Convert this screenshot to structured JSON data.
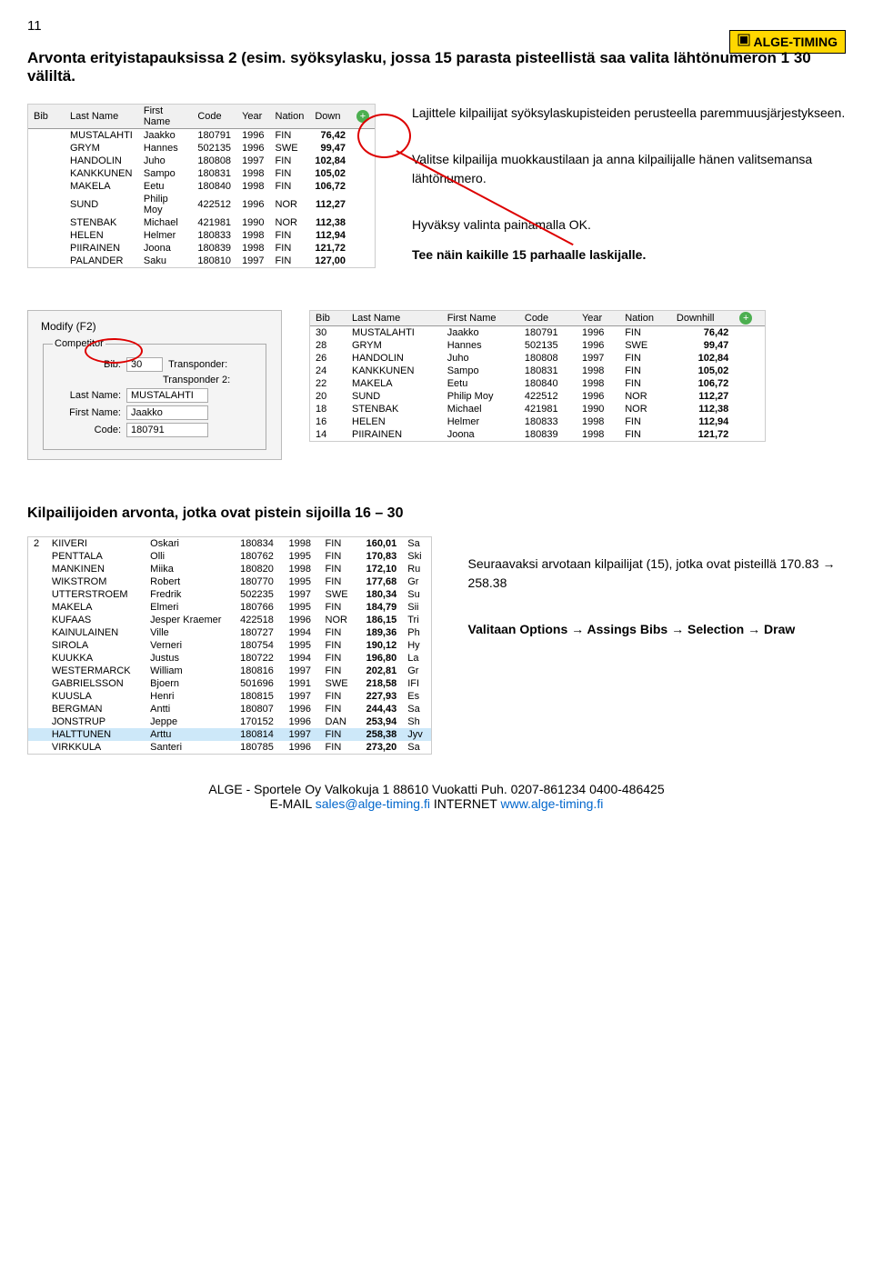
{
  "page_number": "11",
  "logo_text": "ALGE-TIMING",
  "title": "Arvonta erityistapauksissa 2 (esim. syöksylasku, jossa 15 parasta pisteellistä saa valita lähtönumeron 1 30 väliltä.",
  "table1": {
    "headers": [
      "Bib",
      "Last Name",
      "First Name",
      "Code",
      "Year",
      "Nation",
      "Down"
    ],
    "rows": [
      [
        "",
        "MUSTALAHTI",
        "Jaakko",
        "180791",
        "1996",
        "FIN",
        "76,42"
      ],
      [
        "",
        "GRYM",
        "Hannes",
        "502135",
        "1996",
        "SWE",
        "99,47"
      ],
      [
        "",
        "HANDOLIN",
        "Juho",
        "180808",
        "1997",
        "FIN",
        "102,84"
      ],
      [
        "",
        "KANKKUNEN",
        "Sampo",
        "180831",
        "1998",
        "FIN",
        "105,02"
      ],
      [
        "",
        "MAKELA",
        "Eetu",
        "180840",
        "1998",
        "FIN",
        "106,72"
      ],
      [
        "",
        "SUND",
        "Philip Moy",
        "422512",
        "1996",
        "NOR",
        "112,27"
      ],
      [
        "",
        "STENBAK",
        "Michael",
        "421981",
        "1990",
        "NOR",
        "112,38"
      ],
      [
        "",
        "HELEN",
        "Helmer",
        "180833",
        "1998",
        "FIN",
        "112,94"
      ],
      [
        "",
        "PIIRAINEN",
        "Joona",
        "180839",
        "1998",
        "FIN",
        "121,72"
      ],
      [
        "",
        "PALANDER",
        "Saku",
        "180810",
        "1997",
        "FIN",
        "127,00"
      ]
    ]
  },
  "info1": "Lajittele kilpailijat syöksylaskupisteiden perusteella paremmuusjärjestykseen.",
  "info2": "Valitse kilpailija muokkaustilaan ja anna kilpailijalle hänen valitsemansa lähtönumero.",
  "info3": "Hyväksy valinta painamalla OK.",
  "info4": "Tee näin kaikille 15 parhaalle laskijalle.",
  "modify": {
    "title": "Modify (F2)",
    "legend": "Competitor",
    "bib_lbl": "Bib:",
    "bib_val": "30",
    "tr_lbl": "Transponder:",
    "tr2_lbl": "Transponder 2:",
    "ln_lbl": "Last Name:",
    "ln_val": "MUSTALAHTI",
    "fn_lbl": "First Name:",
    "fn_val": "Jaakko",
    "code_lbl": "Code:",
    "code_val": "180791"
  },
  "table2": {
    "headers": [
      "Bib",
      "Last Name",
      "First Name",
      "Code",
      "Year",
      "Nation",
      "Downhill"
    ],
    "rows": [
      [
        "30",
        "MUSTALAHTI",
        "Jaakko",
        "180791",
        "1996",
        "FIN",
        "76,42"
      ],
      [
        "28",
        "GRYM",
        "Hannes",
        "502135",
        "1996",
        "SWE",
        "99,47"
      ],
      [
        "26",
        "HANDOLIN",
        "Juho",
        "180808",
        "1997",
        "FIN",
        "102,84"
      ],
      [
        "24",
        "KANKKUNEN",
        "Sampo",
        "180831",
        "1998",
        "FIN",
        "105,02"
      ],
      [
        "22",
        "MAKELA",
        "Eetu",
        "180840",
        "1998",
        "FIN",
        "106,72"
      ],
      [
        "20",
        "SUND",
        "Philip Moy",
        "422512",
        "1996",
        "NOR",
        "112,27"
      ],
      [
        "18",
        "STENBAK",
        "Michael",
        "421981",
        "1990",
        "NOR",
        "112,38"
      ],
      [
        "16",
        "HELEN",
        "Helmer",
        "180833",
        "1998",
        "FIN",
        "112,94"
      ],
      [
        "14",
        "PIIRAINEN",
        "Joona",
        "180839",
        "1998",
        "FIN",
        "121,72"
      ]
    ]
  },
  "section2_title": "Kilpailijoiden arvonta, jotka ovat pistein sijoilla 16 – 30",
  "table3": {
    "rows": [
      [
        "2",
        "KIIVERI",
        "Oskari",
        "180834",
        "1998",
        "FIN",
        "160,01",
        "Sa"
      ],
      [
        "",
        "PENTTALA",
        "Olli",
        "180762",
        "1995",
        "FIN",
        "170,83",
        "Ski"
      ],
      [
        "",
        "MANKINEN",
        "Miika",
        "180820",
        "1998",
        "FIN",
        "172,10",
        "Ru"
      ],
      [
        "",
        "WIKSTROM",
        "Robert",
        "180770",
        "1995",
        "FIN",
        "177,68",
        "Gr"
      ],
      [
        "",
        "UTTERSTROEM",
        "Fredrik",
        "502235",
        "1997",
        "SWE",
        "180,34",
        "Su"
      ],
      [
        "",
        "MAKELA",
        "Elmeri",
        "180766",
        "1995",
        "FIN",
        "184,79",
        "Sii"
      ],
      [
        "",
        "KUFAAS",
        "Jesper Kraemer",
        "422518",
        "1996",
        "NOR",
        "186,15",
        "Tri"
      ],
      [
        "",
        "KAINULAINEN",
        "Ville",
        "180727",
        "1994",
        "FIN",
        "189,36",
        "Ph"
      ],
      [
        "",
        "SIROLA",
        "Verneri",
        "180754",
        "1995",
        "FIN",
        "190,12",
        "Hy"
      ],
      [
        "",
        "KUUKKA",
        "Justus",
        "180722",
        "1994",
        "FIN",
        "196,80",
        "La"
      ],
      [
        "",
        "WESTERMARCK",
        "William",
        "180816",
        "1997",
        "FIN",
        "202,81",
        "Gr"
      ],
      [
        "",
        "GABRIELSSON",
        "Bjoern",
        "501696",
        "1991",
        "SWE",
        "218,58",
        "IFI"
      ],
      [
        "",
        "KUUSLA",
        "Henri",
        "180815",
        "1997",
        "FIN",
        "227,93",
        "Es"
      ],
      [
        "",
        "BERGMAN",
        "Antti",
        "180807",
        "1996",
        "FIN",
        "244,43",
        "Sa"
      ],
      [
        "",
        "JONSTRUP",
        "Jeppe",
        "170152",
        "1996",
        "DAN",
        "253,94",
        "Sh"
      ],
      [
        "",
        "HALTTUNEN",
        "Arttu",
        "180814",
        "1997",
        "FIN",
        "258,38",
        "Jyv"
      ],
      [
        "",
        "VIRKKULA",
        "Santeri",
        "180785",
        "1996",
        "FIN",
        "273,20",
        "Sa"
      ]
    ]
  },
  "info5a": "Seuraavaksi arvotaan kilpailijat (15), jotka ovat pisteillä 170.83 ",
  "info5b": " 258.38",
  "info6a": "Valitaan Options ",
  "info6b": " Assings Bibs ",
  "info6c": " Selection ",
  "info6d": " Draw",
  "arrow": "→",
  "footer": {
    "l1": "ALGE - Sportele Oy Valkokuja 1 88610 Vuokatti  Puh. 0207-861234  0400-486425",
    "l2a": "E-MAIL ",
    "l2b": "sales@alge-timing.fi",
    "l2c": "  INTERNET ",
    "l2d": "www.alge-timing.fi"
  }
}
